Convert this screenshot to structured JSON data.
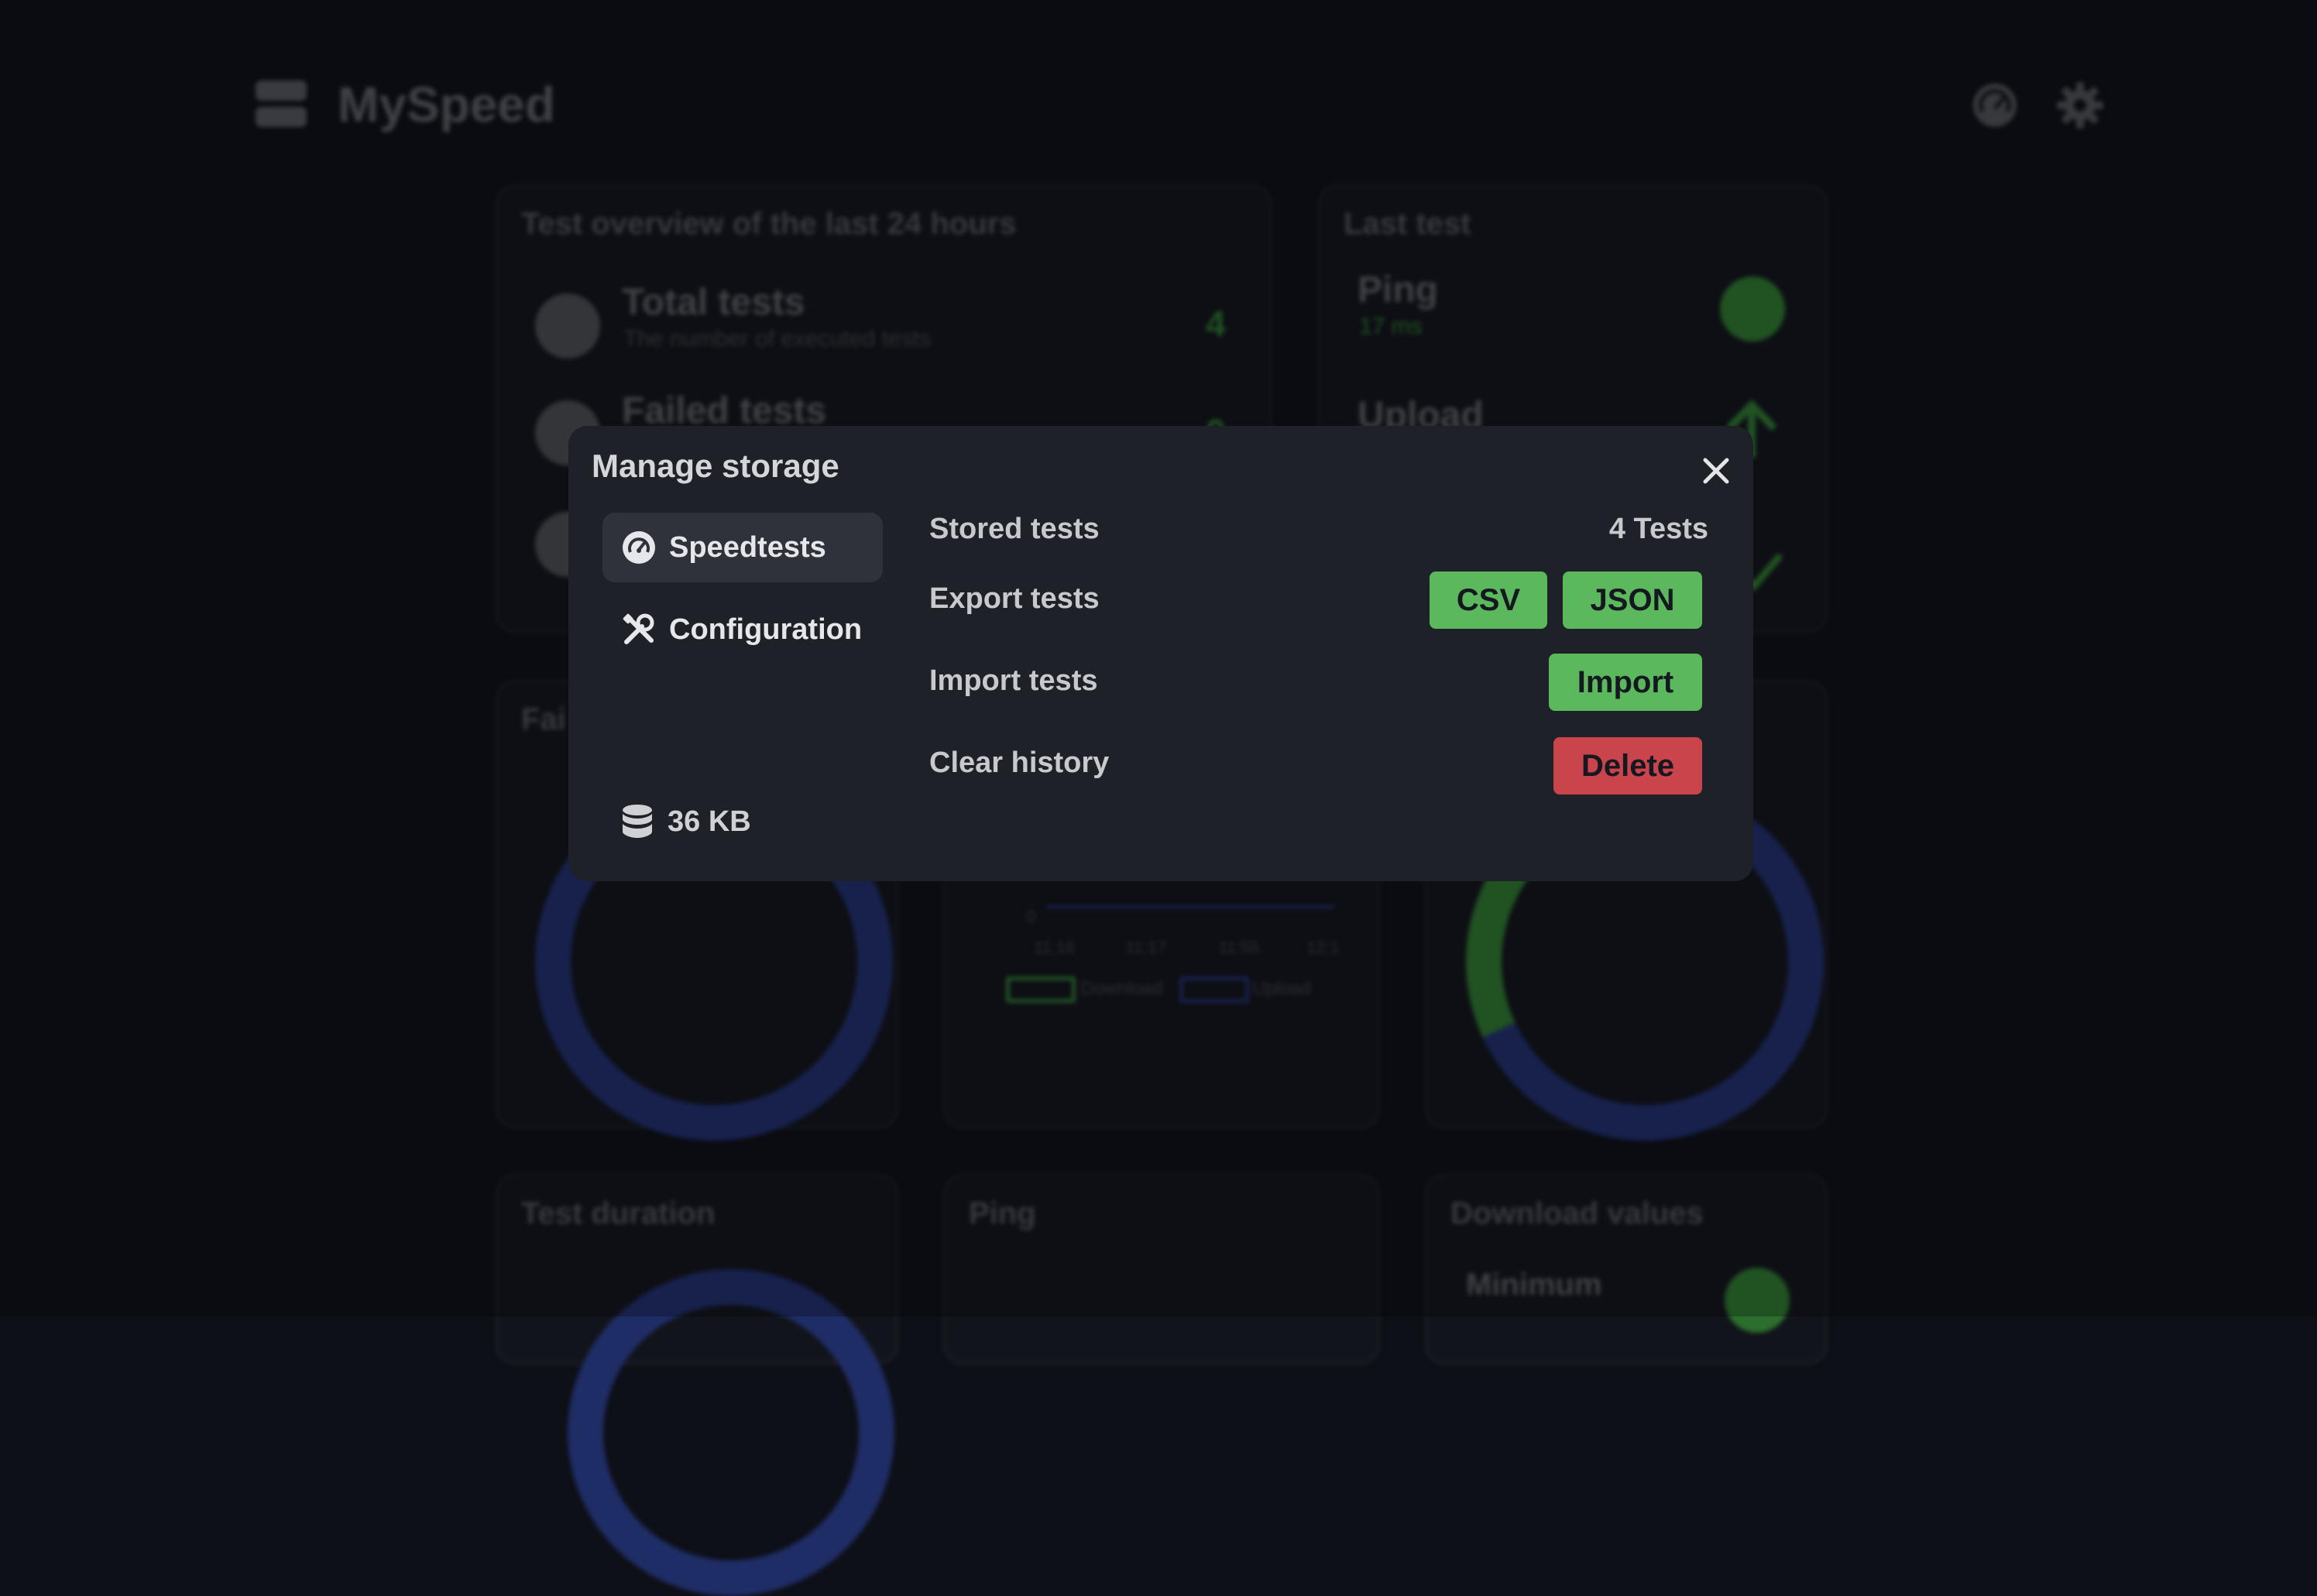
{
  "app": {
    "title": "MySpeed"
  },
  "background": {
    "overview": {
      "title": "Test overview of the last 24 hours",
      "total_label": "Total tests",
      "total_sub": "The number of executed tests",
      "total_value": "4",
      "failed_label": "Failed tests",
      "failed_value": "0"
    },
    "last_test": {
      "title": "Last test",
      "ping_label": "Ping",
      "ping_value": "17 ms",
      "upload_label": "Upload"
    },
    "failed_card_title": "Fai",
    "chart": {
      "y_zero": "0",
      "x_ticks": [
        "11:16",
        "11:17",
        "11:55",
        "12:1"
      ],
      "legend": [
        "Download",
        "Upload"
      ]
    },
    "bottom": {
      "duration_title": "Test duration",
      "ping_title": "Ping",
      "download_title": "Download values",
      "minimum_label": "Minimum"
    }
  },
  "modal": {
    "title": "Manage storage",
    "nav": {
      "speedtests": "Speedtests",
      "configuration": "Configuration"
    },
    "storage_size": "36 KB",
    "rows": {
      "stored_label": "Stored tests",
      "stored_value": "4 Tests",
      "export_label": "Export tests",
      "csv_button": "CSV",
      "json_button": "JSON",
      "import_label": "Import tests",
      "import_button": "Import",
      "clear_label": "Clear history",
      "delete_button": "Delete"
    }
  },
  "colors": {
    "success": "#5cb85c",
    "danger": "#c9444b",
    "modal_bg": "#1f2129",
    "page_bg": "#0e1017"
  },
  "icons": {
    "logo": "server-icon",
    "top_speedtest": "speedometer-icon",
    "top_settings": "gear-icon",
    "close": "close-icon",
    "speedtests": "speedometer-icon",
    "configuration": "tools-icon",
    "storage": "database-icon"
  }
}
